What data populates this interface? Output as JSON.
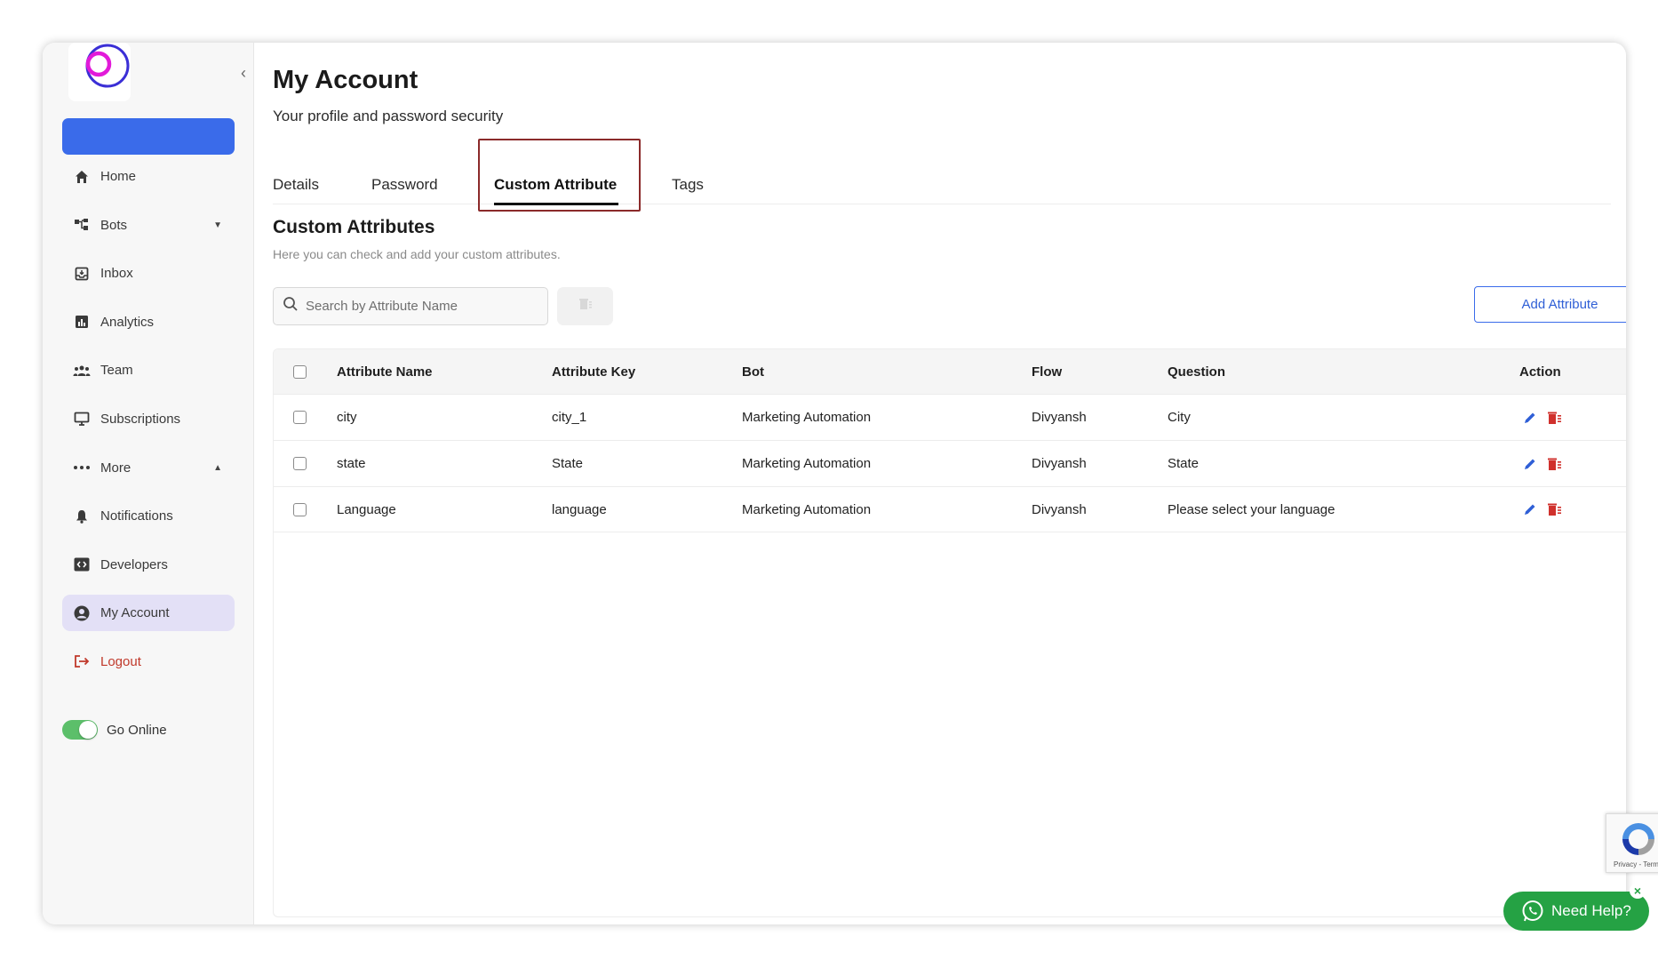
{
  "page": {
    "title": "My Account",
    "subtitle": "Your profile and password security"
  },
  "sidebar": {
    "items": [
      {
        "label": "Home",
        "icon": "home-icon"
      },
      {
        "label": "Bots",
        "icon": "bots-icon",
        "caret": "▼"
      },
      {
        "label": "Inbox",
        "icon": "inbox-icon"
      },
      {
        "label": "Analytics",
        "icon": "analytics-icon"
      },
      {
        "label": "Team",
        "icon": "team-icon"
      },
      {
        "label": "Subscriptions",
        "icon": "subscriptions-icon"
      },
      {
        "label": "More",
        "icon": "more-icon",
        "caret": "▲"
      },
      {
        "label": "Notifications",
        "icon": "bell-icon"
      },
      {
        "label": "Developers",
        "icon": "code-icon"
      },
      {
        "label": "My Account",
        "icon": "account-icon",
        "active": true
      },
      {
        "label": "Logout",
        "icon": "logout-icon"
      }
    ],
    "online_label": "Go Online",
    "online_enabled": true
  },
  "tabs": [
    {
      "label": "Details"
    },
    {
      "label": "Password"
    },
    {
      "label": "Custom Attribute",
      "active": true
    },
    {
      "label": "Tags"
    }
  ],
  "section": {
    "title": "Custom Attributes",
    "subtitle": "Here you can check and add your custom attributes."
  },
  "search": {
    "placeholder": "Search by Attribute Name",
    "value": ""
  },
  "add_button_label": "Add Attribute",
  "table": {
    "columns": [
      "Attribute Name",
      "Attribute Key",
      "Bot",
      "Flow",
      "Question",
      "Action"
    ],
    "rows": [
      {
        "name": "city",
        "key": "city_1",
        "bot": "Marketing Automation",
        "flow": "Divyansh",
        "question": "City"
      },
      {
        "name": "state",
        "key": "State",
        "bot": "Marketing Automation",
        "flow": "Divyansh",
        "question": "State"
      },
      {
        "name": "Language",
        "key": "language",
        "bot": "Marketing Automation",
        "flow": "Divyansh",
        "question": "Please select your language"
      }
    ]
  },
  "recaptcha": {
    "text": "Privacy - Terms"
  },
  "help": {
    "label": "Need Help?",
    "close": "×"
  },
  "colors": {
    "accent": "#3a6bea",
    "active_nav_bg": "#e3e0f6",
    "logout": "#c0392b",
    "edit_icon": "#2f5fd6",
    "delete_icon": "#d0312d",
    "whatsapp": "#25a244",
    "tab_highlight": "#8b2a2a"
  }
}
